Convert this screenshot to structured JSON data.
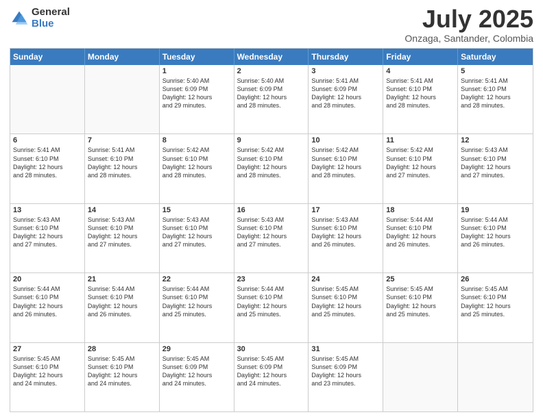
{
  "header": {
    "logo_general": "General",
    "logo_blue": "Blue",
    "month_title": "July 2025",
    "location": "Onzaga, Santander, Colombia"
  },
  "calendar": {
    "days_of_week": [
      "Sunday",
      "Monday",
      "Tuesday",
      "Wednesday",
      "Thursday",
      "Friday",
      "Saturday"
    ],
    "weeks": [
      [
        {
          "day": "",
          "empty": true
        },
        {
          "day": "",
          "empty": true
        },
        {
          "day": "1",
          "sunrise": "5:40 AM",
          "sunset": "6:09 PM",
          "daylight": "12 hours and 29 minutes."
        },
        {
          "day": "2",
          "sunrise": "5:40 AM",
          "sunset": "6:09 PM",
          "daylight": "12 hours and 28 minutes."
        },
        {
          "day": "3",
          "sunrise": "5:41 AM",
          "sunset": "6:09 PM",
          "daylight": "12 hours and 28 minutes."
        },
        {
          "day": "4",
          "sunrise": "5:41 AM",
          "sunset": "6:10 PM",
          "daylight": "12 hours and 28 minutes."
        },
        {
          "day": "5",
          "sunrise": "5:41 AM",
          "sunset": "6:10 PM",
          "daylight": "12 hours and 28 minutes."
        }
      ],
      [
        {
          "day": "6",
          "sunrise": "5:41 AM",
          "sunset": "6:10 PM",
          "daylight": "12 hours and 28 minutes."
        },
        {
          "day": "7",
          "sunrise": "5:41 AM",
          "sunset": "6:10 PM",
          "daylight": "12 hours and 28 minutes."
        },
        {
          "day": "8",
          "sunrise": "5:42 AM",
          "sunset": "6:10 PM",
          "daylight": "12 hours and 28 minutes."
        },
        {
          "day": "9",
          "sunrise": "5:42 AM",
          "sunset": "6:10 PM",
          "daylight": "12 hours and 28 minutes."
        },
        {
          "day": "10",
          "sunrise": "5:42 AM",
          "sunset": "6:10 PM",
          "daylight": "12 hours and 28 minutes."
        },
        {
          "day": "11",
          "sunrise": "5:42 AM",
          "sunset": "6:10 PM",
          "daylight": "12 hours and 27 minutes."
        },
        {
          "day": "12",
          "sunrise": "5:43 AM",
          "sunset": "6:10 PM",
          "daylight": "12 hours and 27 minutes."
        }
      ],
      [
        {
          "day": "13",
          "sunrise": "5:43 AM",
          "sunset": "6:10 PM",
          "daylight": "12 hours and 27 minutes."
        },
        {
          "day": "14",
          "sunrise": "5:43 AM",
          "sunset": "6:10 PM",
          "daylight": "12 hours and 27 minutes."
        },
        {
          "day": "15",
          "sunrise": "5:43 AM",
          "sunset": "6:10 PM",
          "daylight": "12 hours and 27 minutes."
        },
        {
          "day": "16",
          "sunrise": "5:43 AM",
          "sunset": "6:10 PM",
          "daylight": "12 hours and 27 minutes."
        },
        {
          "day": "17",
          "sunrise": "5:43 AM",
          "sunset": "6:10 PM",
          "daylight": "12 hours and 26 minutes."
        },
        {
          "day": "18",
          "sunrise": "5:44 AM",
          "sunset": "6:10 PM",
          "daylight": "12 hours and 26 minutes."
        },
        {
          "day": "19",
          "sunrise": "5:44 AM",
          "sunset": "6:10 PM",
          "daylight": "12 hours and 26 minutes."
        }
      ],
      [
        {
          "day": "20",
          "sunrise": "5:44 AM",
          "sunset": "6:10 PM",
          "daylight": "12 hours and 26 minutes."
        },
        {
          "day": "21",
          "sunrise": "5:44 AM",
          "sunset": "6:10 PM",
          "daylight": "12 hours and 26 minutes."
        },
        {
          "day": "22",
          "sunrise": "5:44 AM",
          "sunset": "6:10 PM",
          "daylight": "12 hours and 25 minutes."
        },
        {
          "day": "23",
          "sunrise": "5:44 AM",
          "sunset": "6:10 PM",
          "daylight": "12 hours and 25 minutes."
        },
        {
          "day": "24",
          "sunrise": "5:45 AM",
          "sunset": "6:10 PM",
          "daylight": "12 hours and 25 minutes."
        },
        {
          "day": "25",
          "sunrise": "5:45 AM",
          "sunset": "6:10 PM",
          "daylight": "12 hours and 25 minutes."
        },
        {
          "day": "26",
          "sunrise": "5:45 AM",
          "sunset": "6:10 PM",
          "daylight": "12 hours and 25 minutes."
        }
      ],
      [
        {
          "day": "27",
          "sunrise": "5:45 AM",
          "sunset": "6:10 PM",
          "daylight": "12 hours and 24 minutes."
        },
        {
          "day": "28",
          "sunrise": "5:45 AM",
          "sunset": "6:10 PM",
          "daylight": "12 hours and 24 minutes."
        },
        {
          "day": "29",
          "sunrise": "5:45 AM",
          "sunset": "6:09 PM",
          "daylight": "12 hours and 24 minutes."
        },
        {
          "day": "30",
          "sunrise": "5:45 AM",
          "sunset": "6:09 PM",
          "daylight": "12 hours and 24 minutes."
        },
        {
          "day": "31",
          "sunrise": "5:45 AM",
          "sunset": "6:09 PM",
          "daylight": "12 hours and 23 minutes."
        },
        {
          "day": "",
          "empty": true
        },
        {
          "day": "",
          "empty": true
        }
      ]
    ]
  }
}
